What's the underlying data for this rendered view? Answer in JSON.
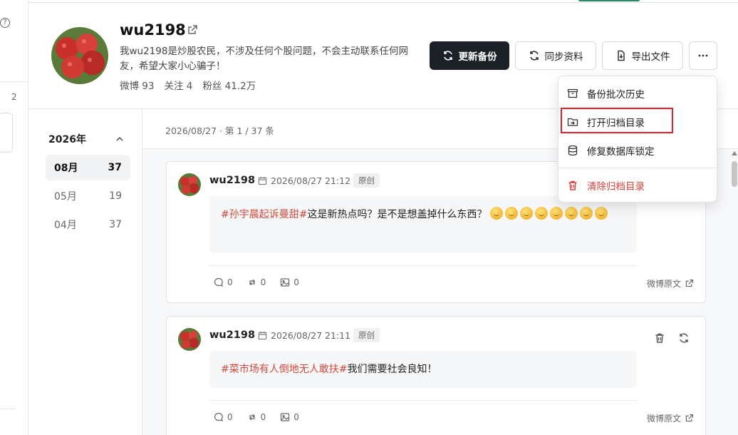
{
  "left_strip": {
    "number": "2"
  },
  "profile": {
    "username": "wu2198",
    "bio": "我wu2198是炒股农民，不涉及任何个股问题，不会主动联系任何网友，希望大家小心骗子！",
    "stats": [
      {
        "label": "微博 93"
      },
      {
        "label": "关注 4"
      },
      {
        "label": "粉丝 41.2万"
      }
    ]
  },
  "toolbar": {
    "update_backup": "更新备份",
    "sync_profile": "同步资料",
    "export_file": "导出文件"
  },
  "dropdown": {
    "items": [
      {
        "label": "备份批次历史",
        "icon": "archive-icon"
      },
      {
        "label": "打开归档目录",
        "icon": "folder-open-icon"
      },
      {
        "label": "修复数据库锁定",
        "icon": "database-icon"
      },
      {
        "label": "清除归档目录",
        "icon": "trash-icon"
      }
    ],
    "danger_color": "#d9423a",
    "highlight_color": "#e0202a"
  },
  "sidebar": {
    "year": "2026年",
    "months": [
      {
        "label": "08月",
        "count": "37",
        "active": true
      },
      {
        "label": "05月",
        "count": "19",
        "active": false
      },
      {
        "label": "04月",
        "count": "37",
        "active": false
      }
    ]
  },
  "feed": {
    "meta": "2026/08/27 · 第 1 / 37 条",
    "posts": [
      {
        "user": "wu2198",
        "date": "2026/08/27 21:12",
        "badge": "原创",
        "tag": "#孙宇晨起诉曼甜#",
        "text": "这是新热点吗？是不是想盖掉什么东西？",
        "emoji_count": 8,
        "comments": "0",
        "reposts": "0",
        "images": "0",
        "link": "微博原文"
      },
      {
        "user": "wu2198",
        "date": "2026/08/27 21:11",
        "badge": "原创",
        "tag": "#菜市场有人倒地无人敢扶#",
        "text": "我们需要社会良知！",
        "comments": "0",
        "reposts": "0",
        "images": "0",
        "link": "微博原文"
      }
    ]
  },
  "colors": {
    "primary_dark": "#1c2127",
    "tag_red": "#d24a3c",
    "accent_green": "#2e8b6a"
  }
}
